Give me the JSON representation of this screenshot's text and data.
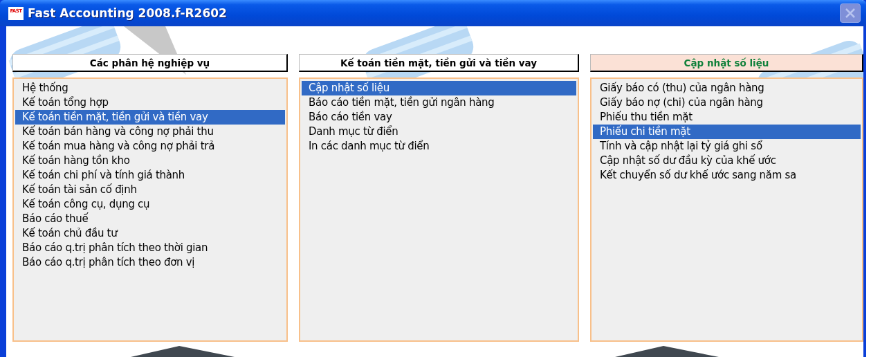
{
  "window": {
    "title": "Fast Accounting 2008.f-R2602",
    "logo_text": "FAST",
    "close_button": {
      "disabled": true
    }
  },
  "panels": [
    {
      "header": "Các phân hệ nghiệp vụ",
      "active": false,
      "items": [
        {
          "label": "Hệ thống",
          "selected": false
        },
        {
          "label": "Kế toán tổng hợp",
          "selected": false
        },
        {
          "label": "Kế toán tiền mặt, tiền gửi và tiền vay",
          "selected": true
        },
        {
          "label": "Kế toán bán hàng và công nợ phải thu",
          "selected": false
        },
        {
          "label": "Kế toán mua hàng và công nợ phải trả",
          "selected": false
        },
        {
          "label": "Kế toán hàng tồn kho",
          "selected": false
        },
        {
          "label": "Kế toán chi phí và tính giá thành",
          "selected": false
        },
        {
          "label": "Kế toán tài sản cố định",
          "selected": false
        },
        {
          "label": "Kế toán công cụ, dụng cụ",
          "selected": false
        },
        {
          "label": "Báo cáo thuế",
          "selected": false
        },
        {
          "label": "Kế toán chủ đầu tư",
          "selected": false
        },
        {
          "label": "Báo cáo q.trị phân tích theo thời gian",
          "selected": false
        },
        {
          "label": "Báo cáo q.trị phân tích theo đơn vị",
          "selected": false
        }
      ]
    },
    {
      "header": "Kế toán tiền mặt, tiền gửi và tiền vay",
      "active": false,
      "items": [
        {
          "label": "Cập nhật số liệu",
          "selected": true
        },
        {
          "label": "Báo cáo tiền mặt, tiền gửi ngân hàng",
          "selected": false
        },
        {
          "label": "Báo cáo tiền vay",
          "selected": false
        },
        {
          "label": "Danh mục từ điển",
          "selected": false
        },
        {
          "label": "In các danh mục từ điển",
          "selected": false
        }
      ]
    },
    {
      "header": "Cập nhật số liệu",
      "active": true,
      "items": [
        {
          "label": "Giấy báo có (thu) của ngân hàng",
          "selected": false
        },
        {
          "label": "Giấy báo nợ (chi) của ngân hàng",
          "selected": false
        },
        {
          "label": "Phiếu thu tiền mặt",
          "selected": false
        },
        {
          "label": "Phiếu chi tiền mặt",
          "selected": true
        },
        {
          "label": "Tính và cập nhật lại tỷ giá ghi sổ",
          "selected": false
        },
        {
          "label": "Cập nhật số dư đầu kỳ của khế ước",
          "selected": false
        },
        {
          "label": "Kết chuyển số dư khế ước sang năm sa",
          "selected": false
        }
      ]
    }
  ]
}
